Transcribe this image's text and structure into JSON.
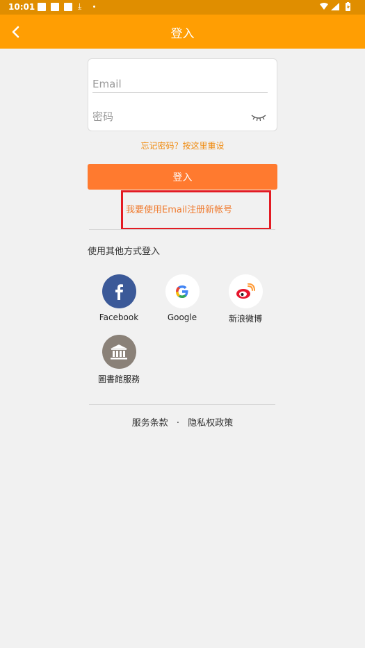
{
  "status_bar": {
    "time": "10:01"
  },
  "app_bar": {
    "title": "登入"
  },
  "form": {
    "email_placeholder": "Email",
    "password_placeholder": "密码"
  },
  "forgot_password": "忘记密码？按这里重设",
  "login_button": "登入",
  "register_link": "我要使用Email注册新帐号",
  "other_login": {
    "title": "使用其他方式登入",
    "options": [
      {
        "label": "Facebook",
        "icon": "facebook-icon",
        "color": "#3b5998"
      },
      {
        "label": "Google",
        "icon": "google-icon",
        "color": "#ffffff"
      },
      {
        "label": "新浪微博",
        "icon": "weibo-icon",
        "color": "#ffffff"
      },
      {
        "label": "圖書館服務",
        "icon": "library-icon",
        "color": "#8a8178"
      }
    ]
  },
  "footer": {
    "terms": "服务条款",
    "separator": "·",
    "privacy": "隐私权政策"
  },
  "colors": {
    "app_bar": "#ff9e03",
    "status_bar": "#e08e00",
    "login_button": "#ff7a2f",
    "highlight_box": "#e31b23"
  }
}
